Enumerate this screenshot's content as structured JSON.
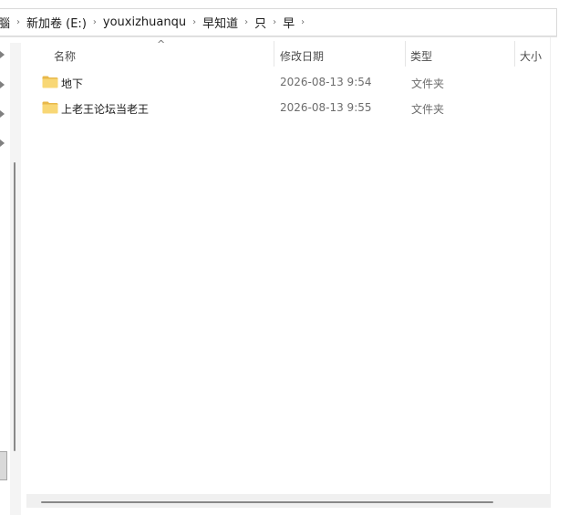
{
  "breadcrumb": {
    "partial_label": "腦",
    "items": [
      {
        "label": "新加卷 (E:)"
      },
      {
        "label": "youxizhuanqu"
      },
      {
        "label": "早知道"
      },
      {
        "label": "只"
      },
      {
        "label": "早"
      }
    ],
    "separator": "›"
  },
  "columns": {
    "sort_indicator": "^",
    "name": "名称",
    "date_modified": "修改日期",
    "type": "类型",
    "size": "大小"
  },
  "files": [
    {
      "name": "地下",
      "date_modified": "2026-08-13 9:54",
      "type": "文件夹",
      "icon": "folder-icon"
    },
    {
      "name": "上老王论坛当老王",
      "date_modified": "2026-08-13 9:55",
      "type": "文件夹",
      "icon": "folder-icon"
    }
  ],
  "colors": {
    "folder_body": "#f8d775",
    "folder_tab": "#e8b84a",
    "scrollbar_thumb": "#888888"
  }
}
